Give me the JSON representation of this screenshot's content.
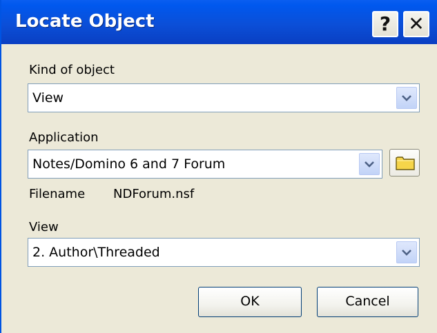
{
  "window": {
    "title": "Locate Object",
    "help_label": "?",
    "close_label": "✕"
  },
  "kind_of_object": {
    "label": "Kind of object",
    "value": "View"
  },
  "application": {
    "label": "Application",
    "value": "Notes/Domino 6 and 7 Forum",
    "browse_icon": "folder-icon"
  },
  "filename": {
    "label": "Filename",
    "value": "NDForum.nsf"
  },
  "view": {
    "label": "View",
    "value": "2. Author\\Threaded"
  },
  "buttons": {
    "ok_label": "OK",
    "cancel_label": "Cancel"
  },
  "colors": {
    "titlebar": "#0a4fd8",
    "dialog_bg": "#ece9d8",
    "field_border": "#7f9db9"
  }
}
